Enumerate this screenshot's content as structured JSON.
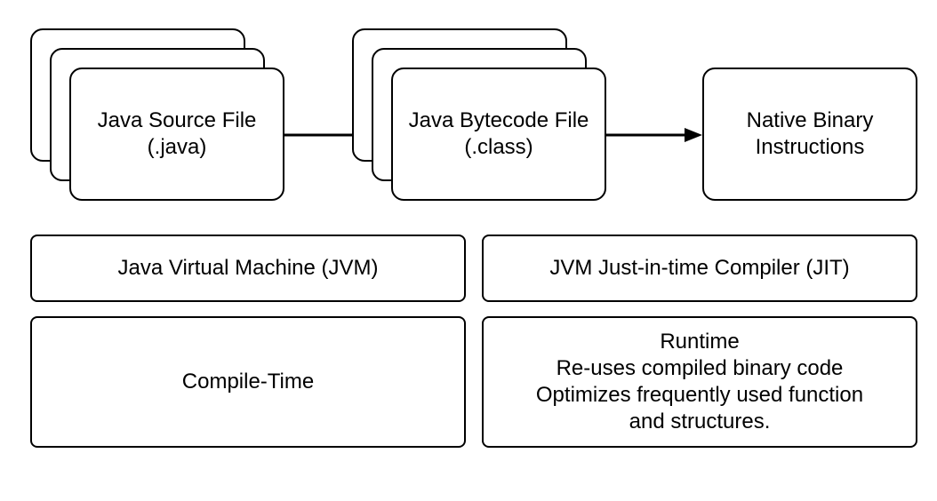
{
  "stage1": {
    "line1": "Java Source File",
    "line2": "(.java)"
  },
  "stage2": {
    "line1": "Java Bytecode File",
    "line2": "(.class)"
  },
  "stage3": {
    "line1": "Native Binary",
    "line2": "Instructions"
  },
  "jvm_label": "Java Virtual Machine (JVM)",
  "compile_time_label": "Compile-Time",
  "jit_label": "JVM Just-in-time Compiler (JIT)",
  "runtime": {
    "title": "Runtime",
    "line1": "Re-uses compiled binary code",
    "line2": "Optimizes frequently used function",
    "line3": "and structures."
  }
}
